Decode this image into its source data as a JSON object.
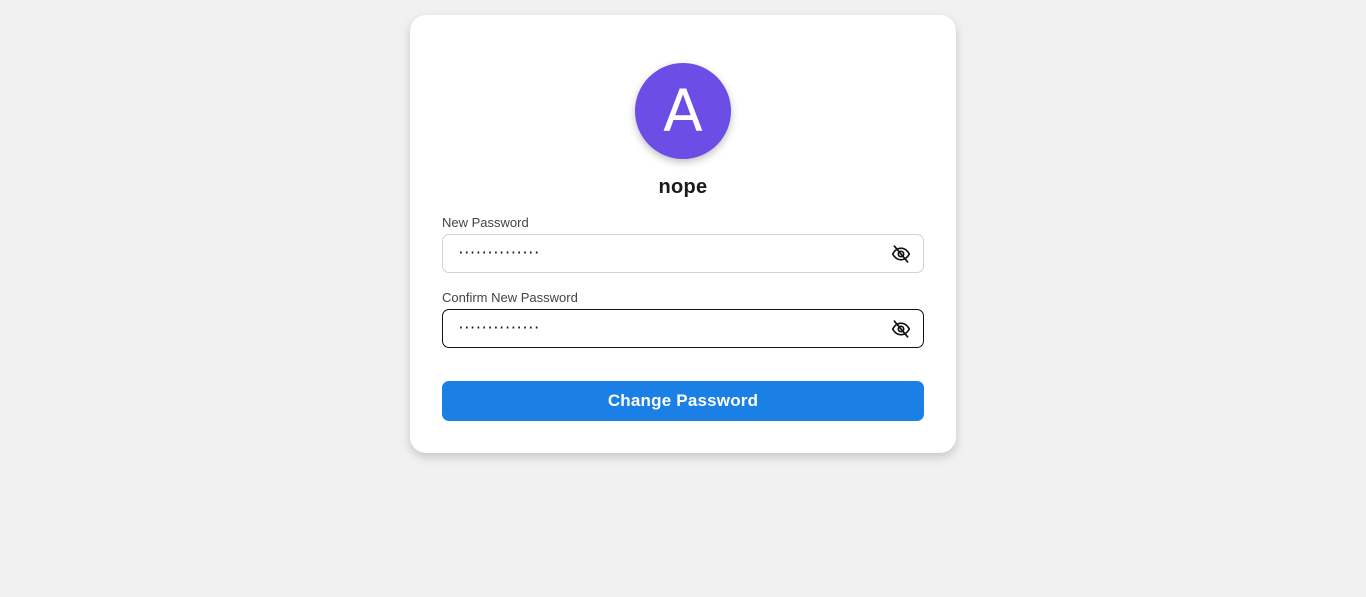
{
  "profile": {
    "avatar_letter": "A",
    "avatar_color": "#6c4de6",
    "username": "nope"
  },
  "form": {
    "new_password": {
      "label": "New Password",
      "value": "··············",
      "toggle_icon": "eye-slash-icon"
    },
    "confirm_password": {
      "label": "Confirm New Password",
      "value": "··············",
      "toggle_icon": "eye-slash-icon"
    },
    "submit_label": "Change Password",
    "accent_color": "#1a80e5"
  }
}
